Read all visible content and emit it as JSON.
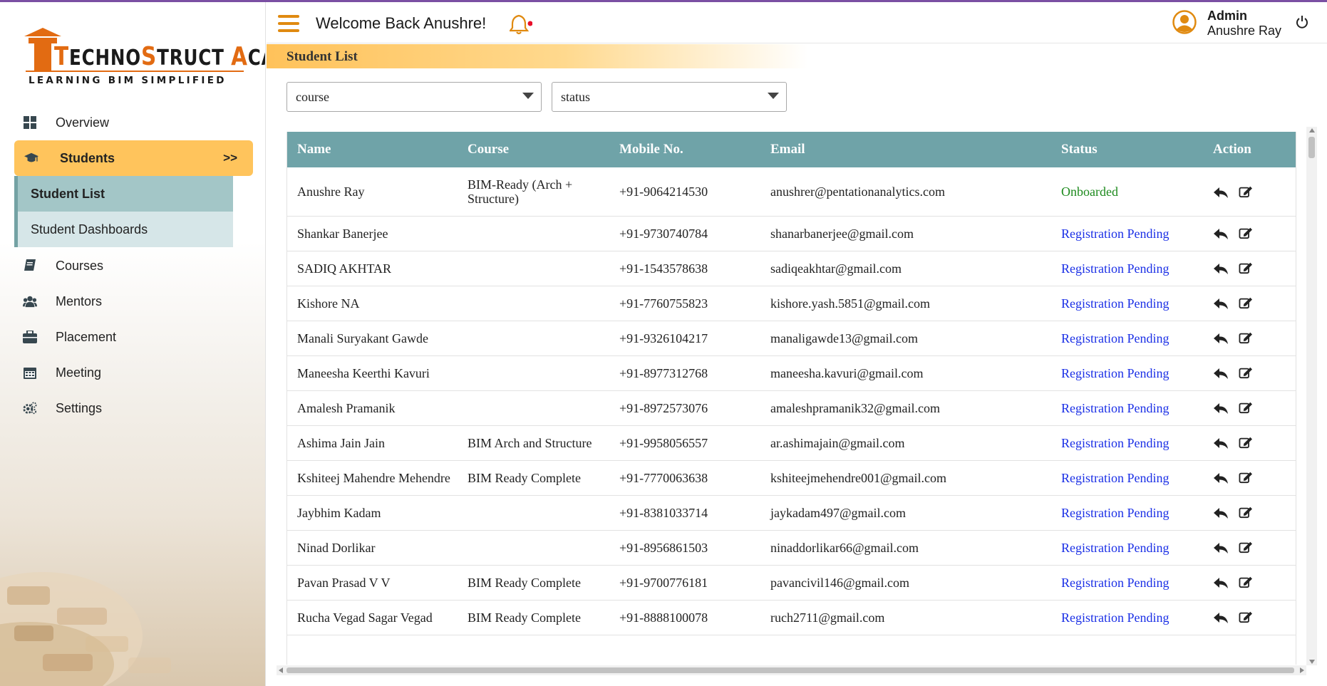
{
  "sidebar": {
    "logo": {
      "title_parts": [
        "T",
        "ECHNO",
        "S",
        "TRUCT ",
        "A",
        "CADEMY"
      ],
      "tagline": "LEARNING BIM SIMPLIFIED"
    },
    "items": [
      {
        "label": "Overview",
        "icon": "grid-icon"
      },
      {
        "label": "Students",
        "icon": "graduation-cap-icon",
        "arrow": ">>"
      },
      {
        "label": "Courses",
        "icon": "book-icon"
      },
      {
        "label": "Mentors",
        "icon": "users-icon"
      },
      {
        "label": "Placement",
        "icon": "briefcase-icon"
      },
      {
        "label": "Meeting",
        "icon": "calendar-icon"
      },
      {
        "label": "Settings",
        "icon": "gears-icon"
      }
    ],
    "sub_items": [
      {
        "label": "Student List"
      },
      {
        "label": "Student Dashboards"
      }
    ]
  },
  "header": {
    "welcome": "Welcome Back Anushre!",
    "admin_role": "Admin",
    "admin_name": "Anushre Ray"
  },
  "page": {
    "title": "Student List"
  },
  "filters": {
    "course": "course",
    "status": "status"
  },
  "table": {
    "headers": [
      "Name",
      "Course",
      "Mobile No.",
      "Email",
      "Status",
      "Action"
    ],
    "rows": [
      {
        "name": "Anushre Ray",
        "course": "BIM-Ready (Arch + Structure)",
        "mobile": "+91-9064214530",
        "email": "anushrer@pentationanalytics.com",
        "status": "Onboarded"
      },
      {
        "name": "Shankar Banerjee",
        "course": "",
        "mobile": "+91-9730740784",
        "email": "shanarbanerjee@gmail.com",
        "status": "Registration Pending"
      },
      {
        "name": "SADIQ AKHTAR",
        "course": "",
        "mobile": "+91-1543578638",
        "email": "sadiqeakhtar@gmail.com",
        "status": "Registration Pending"
      },
      {
        "name": "Kishore NA",
        "course": "",
        "mobile": "+91-7760755823",
        "email": "kishore.yash.5851@gmail.com",
        "status": "Registration Pending"
      },
      {
        "name": "Manali Suryakant Gawde",
        "course": "",
        "mobile": "+91-9326104217",
        "email": "manaligawde13@gmail.com",
        "status": "Registration Pending"
      },
      {
        "name": "Maneesha Keerthi Kavuri",
        "course": "",
        "mobile": "+91-8977312768",
        "email": "maneesha.kavuri@gmail.com",
        "status": "Registration Pending"
      },
      {
        "name": "Amalesh Pramanik",
        "course": "",
        "mobile": "+91-8972573076",
        "email": "amaleshpramanik32@gmail.com",
        "status": "Registration Pending"
      },
      {
        "name": "Ashima Jain Jain",
        "course": "BIM Arch and Structure",
        "mobile": "+91-9958056557",
        "email": "ar.ashimajain@gmail.com",
        "status": "Registration Pending"
      },
      {
        "name": "Kshiteej Mahendre Mehendre",
        "course": "BIM Ready Complete",
        "mobile": "+91-7770063638",
        "email": "kshiteejmehendre001@gmail.com",
        "status": "Registration Pending"
      },
      {
        "name": "Jaybhim Kadam",
        "course": "",
        "mobile": "+91-8381033714",
        "email": "jaykadam497@gmail.com",
        "status": "Registration Pending"
      },
      {
        "name": "Ninad Dorlikar",
        "course": "",
        "mobile": "+91-8956861503",
        "email": "ninaddorlikar66@gmail.com",
        "status": "Registration Pending"
      },
      {
        "name": "Pavan Prasad V V",
        "course": "BIM Ready Complete",
        "mobile": "+91-9700776181",
        "email": "pavancivil146@gmail.com",
        "status": "Registration Pending"
      },
      {
        "name": "Rucha Vegad Sagar Vegad",
        "course": "BIM Ready Complete",
        "mobile": "+91-8888100078",
        "email": "ruch2711@gmail.com",
        "status": "Registration Pending"
      }
    ]
  },
  "colors": {
    "accent": "#ffc45c",
    "table_header": "#6fa3a8",
    "status_onboarded": "#1d8a1d",
    "status_pending": "#1a2fe6"
  }
}
